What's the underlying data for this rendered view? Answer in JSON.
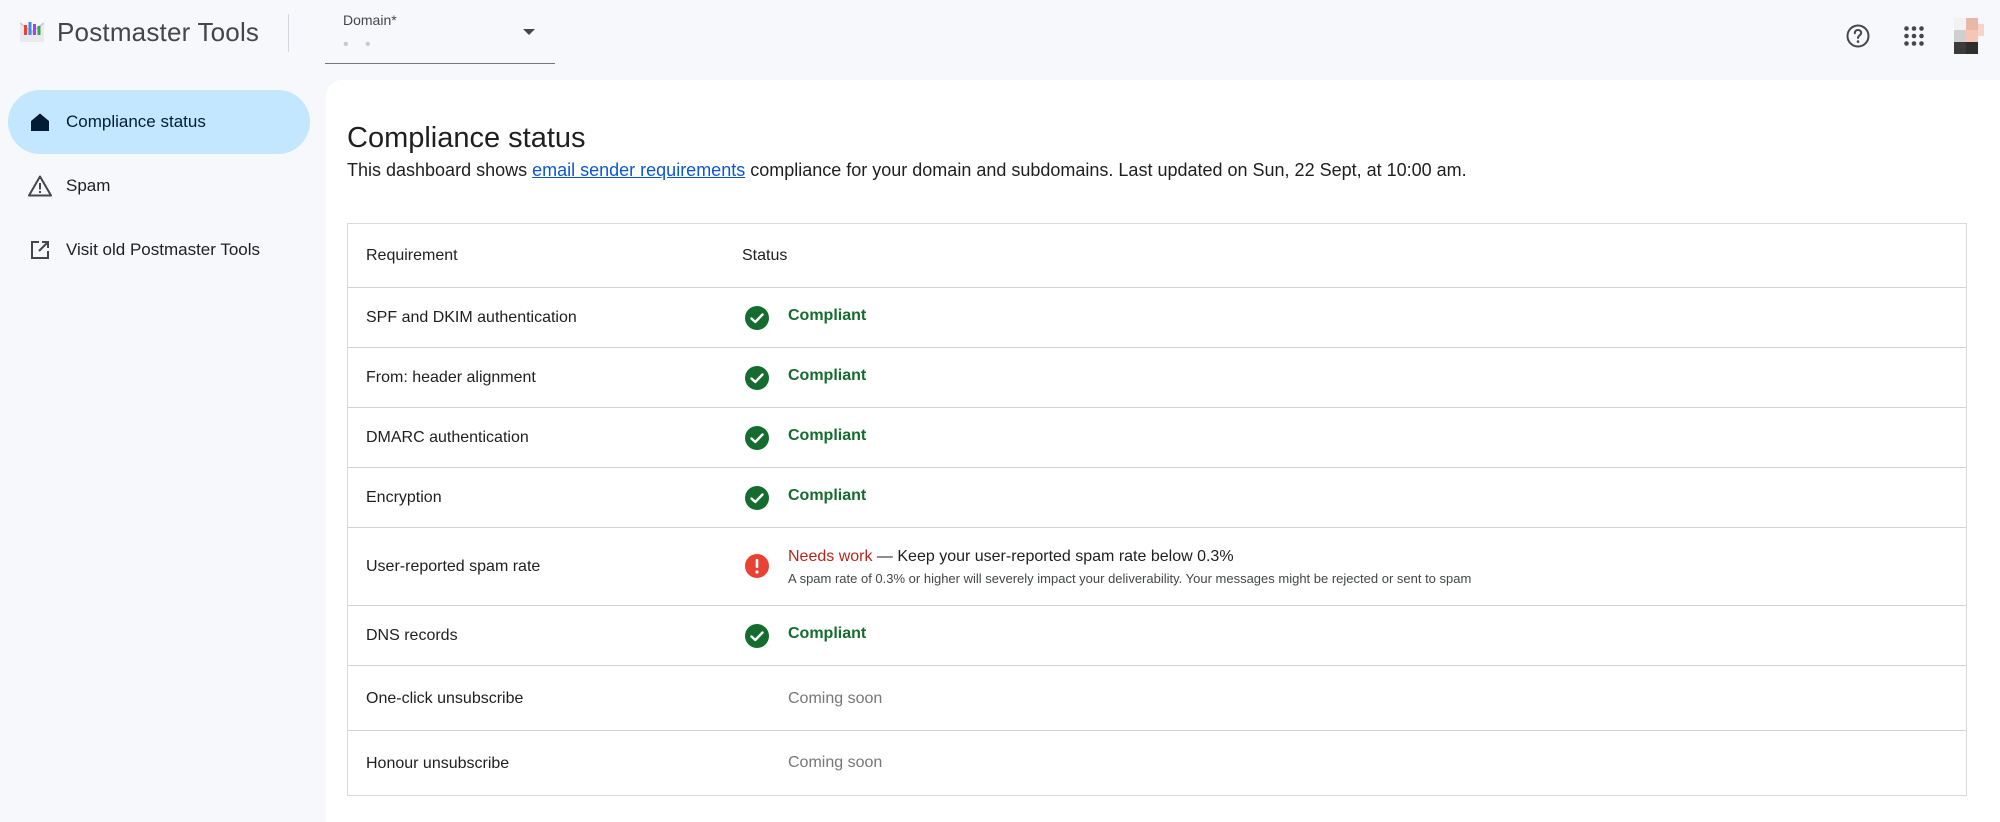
{
  "header": {
    "app_title": "Postmaster Tools",
    "domain_label": "Domain*",
    "domain_value": "• •",
    "icons": [
      "help-icon",
      "apps-grid-icon",
      "avatar"
    ]
  },
  "sidebar": {
    "items": [
      {
        "label": "Compliance status",
        "icon": "home-icon",
        "active": true
      },
      {
        "label": "Spam",
        "icon": "warning-icon",
        "active": false
      },
      {
        "label": "Visit old Postmaster Tools",
        "icon": "open-in-new-icon",
        "active": false
      }
    ]
  },
  "main": {
    "title": "Compliance status",
    "subtitle_before": "This dashboard shows ",
    "subtitle_link": "email sender requirements",
    "subtitle_after": " compliance for your domain and subdomains. Last updated on Sun, 22 Sept, at 10:00 am.",
    "table": {
      "headers": [
        "Requirement",
        "Status"
      ],
      "rows": [
        {
          "requirement": "SPF and DKIM authentication",
          "status": "Compliant"
        },
        {
          "requirement": "From: header alignment",
          "status": "Compliant"
        },
        {
          "requirement": "DMARC authentication",
          "status": "Compliant"
        },
        {
          "requirement": "Encryption",
          "status": "Compliant"
        },
        {
          "requirement": "User-reported spam rate",
          "status": "Needs work",
          "status_tail": " — Keep your user-reported spam rate below 0.3%",
          "detail": "A spam rate of 0.3% or higher will severely impact your deliverability. Your messages might be rejected or sent to spam"
        },
        {
          "requirement": "DNS records",
          "status": "Compliant"
        },
        {
          "requirement": "One-click unsubscribe",
          "status": "Coming soon"
        },
        {
          "requirement": "Honour unsubscribe",
          "status": "Coming soon"
        }
      ]
    }
  },
  "colors": {
    "accent": "#0b57d0",
    "active_nav": "#c2e7ff",
    "compliant": "#146c2e",
    "needs_work": "#b3261e",
    "coming_soon": "#747775"
  }
}
